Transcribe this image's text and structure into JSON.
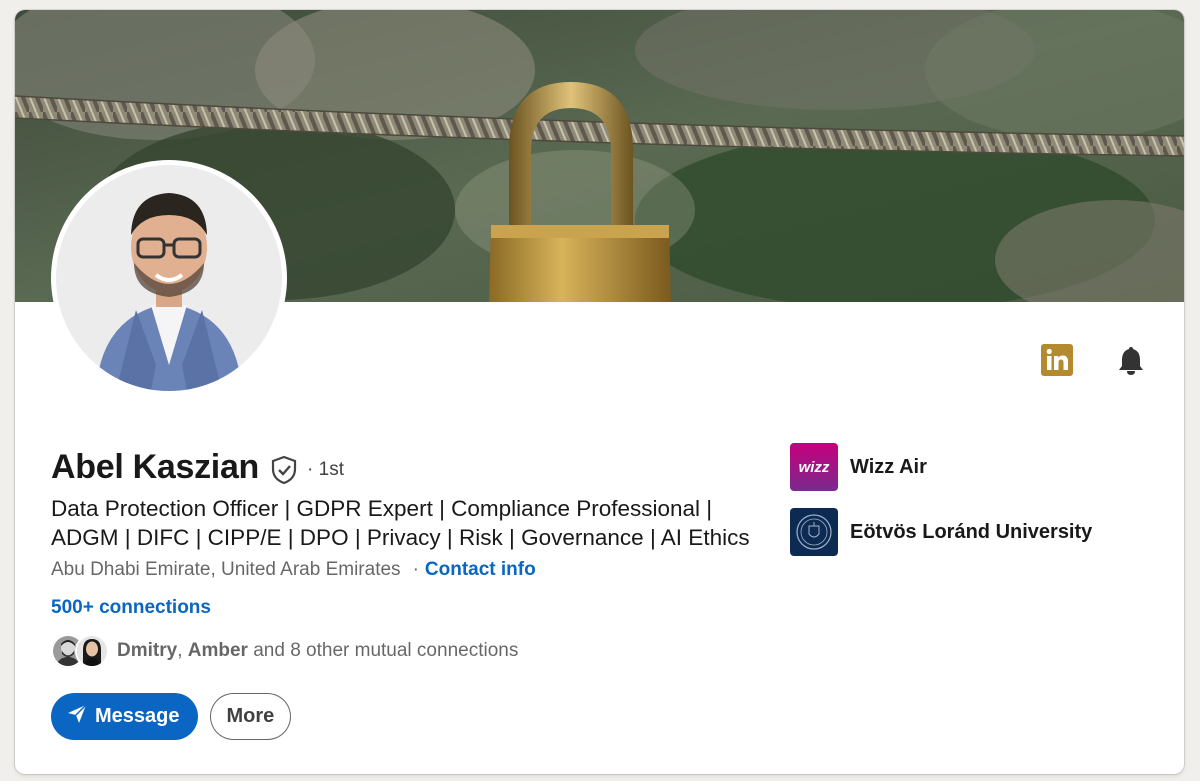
{
  "profile": {
    "name": "Abel Kaszian",
    "degree": "· 1st",
    "headline": "Data Protection Officer | GDPR Expert | Compliance Professional | ADGM | DIFC | CIPP/E | DPO | Privacy | Risk | Governance | AI Ethics",
    "location": "Abu Dhabi Emirate, United Arab Emirates",
    "separator": "·",
    "contact_info": "Contact info",
    "connections": "500+ connections"
  },
  "mutual": {
    "name1": "Dmitry",
    "comma": ",",
    "name2": "Amber",
    "rest": " and 8 other mutual connections"
  },
  "actions": {
    "message": "Message",
    "more": "More"
  },
  "organizations": [
    {
      "name": "Wizz Air",
      "logo_text": "wizz",
      "icon": "wizz-air-logo"
    },
    {
      "name": "Eötvös Loránd University",
      "icon": "elte-seal-logo"
    }
  ],
  "icons": {
    "linkedin": "linkedin-icon",
    "bell": "bell-icon",
    "verified": "shield-check-icon",
    "send": "paper-plane-icon"
  },
  "colors": {
    "accent": "#0a66c2",
    "linkedin_badge": "#b58a2e"
  }
}
